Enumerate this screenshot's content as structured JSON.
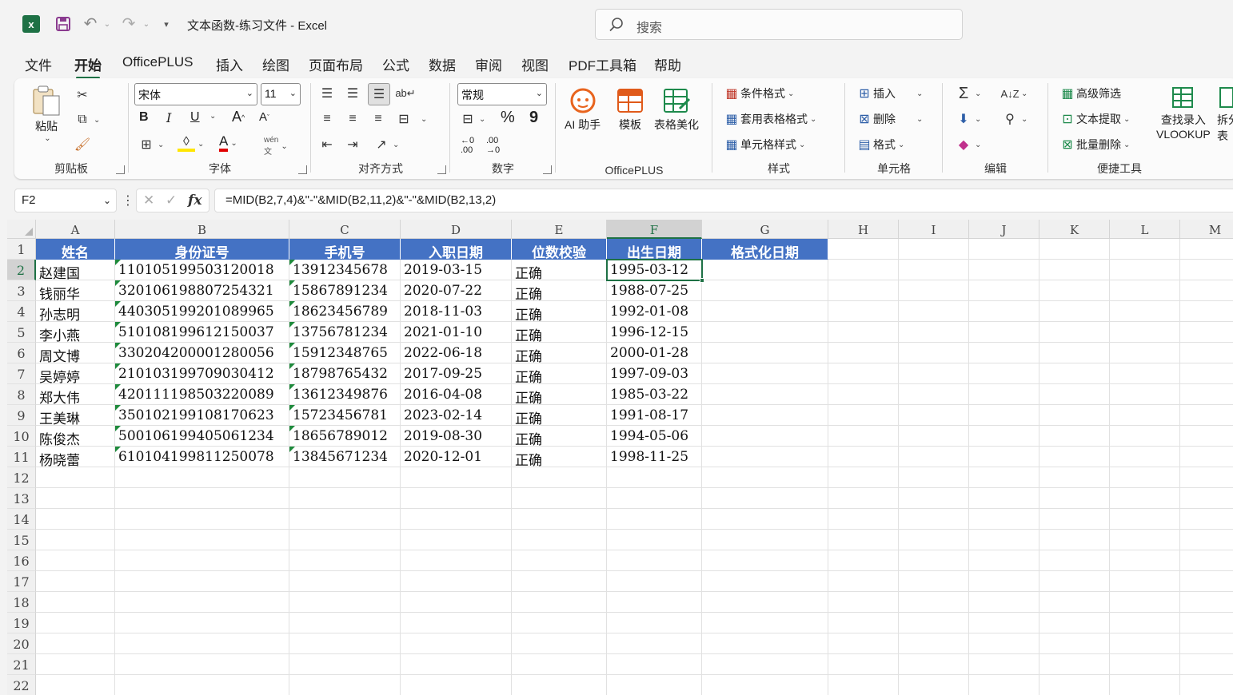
{
  "titlebar": {
    "logo_text": "x",
    "doc_title": "文本函数-练习文件  -  Excel",
    "search_placeholder": "搜索"
  },
  "menu": [
    "文件",
    "开始",
    "OfficePLUS",
    "插入",
    "绘图",
    "页面布局",
    "公式",
    "数据",
    "审阅",
    "视图",
    "PDF工具箱",
    "帮助"
  ],
  "ribbon": {
    "clipboard": {
      "paste": "粘贴",
      "label": "剪贴板"
    },
    "font": {
      "name": "宋体",
      "size": "11",
      "bold": "B",
      "italic": "I",
      "underline": "U",
      "grow": "A",
      "shrink": "A",
      "label": "字体",
      "fontcolor": "A"
    },
    "align": {
      "label": "对齐方式"
    },
    "number": {
      "format": "常规",
      "pct": "%",
      "comma": "9",
      "label": "数字"
    },
    "officeplus": {
      "ai": "AI 助手",
      "template": "模板",
      "beautify": "表格美化",
      "label": "OfficePLUS"
    },
    "styles": {
      "cond": "条件格式",
      "table": "套用表格格式",
      "cell": "单元格样式",
      "label": "样式"
    },
    "cells": {
      "insert": "插入",
      "delete": "删除",
      "format": "格式",
      "label": "单元格"
    },
    "edit": {
      "label": "编辑"
    },
    "tools": {
      "adv_filter": "高级筛选",
      "text_extract": "文本提取",
      "batch_delete": "批量删除",
      "lookup_line1": "查找录入",
      "lookup_line2": "VLOOKUP",
      "split_line1": "拆分",
      "split_line2": "表",
      "label": "便捷工具"
    }
  },
  "formula_bar": {
    "name_box": "F2",
    "formula": "=MID(B2,7,4)&\"-\"&MID(B2,11,2)&\"-\"&MID(B2,13,2)"
  },
  "sheet": {
    "columns": [
      "A",
      "B",
      "C",
      "D",
      "E",
      "F",
      "G",
      "H",
      "I",
      "J",
      "K",
      "L",
      "M"
    ],
    "headers": [
      "姓名",
      "身份证号",
      "手机号",
      "入职日期",
      "位数校验",
      "出生日期",
      "格式化日期"
    ],
    "rows": [
      [
        "赵建国",
        "110105199503120018",
        "13912345678",
        "2019-03-15",
        "正确",
        "1995-03-12"
      ],
      [
        "钱丽华",
        "320106198807254321",
        "15867891234",
        "2020-07-22",
        "正确",
        "1988-07-25"
      ],
      [
        "孙志明",
        "440305199201089965",
        "18623456789",
        "2018-11-03",
        "正确",
        "1992-01-08"
      ],
      [
        "李小燕",
        "510108199612150037",
        "13756781234",
        "2021-01-10",
        "正确",
        "1996-12-15"
      ],
      [
        "周文博",
        "330204200001280056",
        "15912348765",
        "2022-06-18",
        "正确",
        "2000-01-28"
      ],
      [
        "吴婷婷",
        "210103199709030412",
        "18798765432",
        "2017-09-25",
        "正确",
        "1997-09-03"
      ],
      [
        "郑大伟",
        "420111198503220089",
        "13612349876",
        "2016-04-08",
        "正确",
        "1985-03-22"
      ],
      [
        "王美琳",
        "350102199108170623",
        "15723456781",
        "2023-02-14",
        "正确",
        "1991-08-17"
      ],
      [
        "陈俊杰",
        "500106199405061234",
        "18656789012",
        "2019-08-30",
        "正确",
        "1994-05-06"
      ],
      [
        "杨晓蕾",
        "610104199811250078",
        "13845671234",
        "2020-12-01",
        "正确",
        "1998-11-25"
      ]
    ],
    "row_numbers": [
      "1",
      "2",
      "3",
      "4",
      "5",
      "6",
      "7",
      "8",
      "9",
      "10",
      "11",
      "12",
      "13",
      "14",
      "15",
      "16",
      "17",
      "18",
      "19",
      "20",
      "21",
      "22"
    ],
    "selected_cell": "F2"
  },
  "colors": {
    "accent": "#1e7145",
    "header_fill": "#4472c4"
  }
}
